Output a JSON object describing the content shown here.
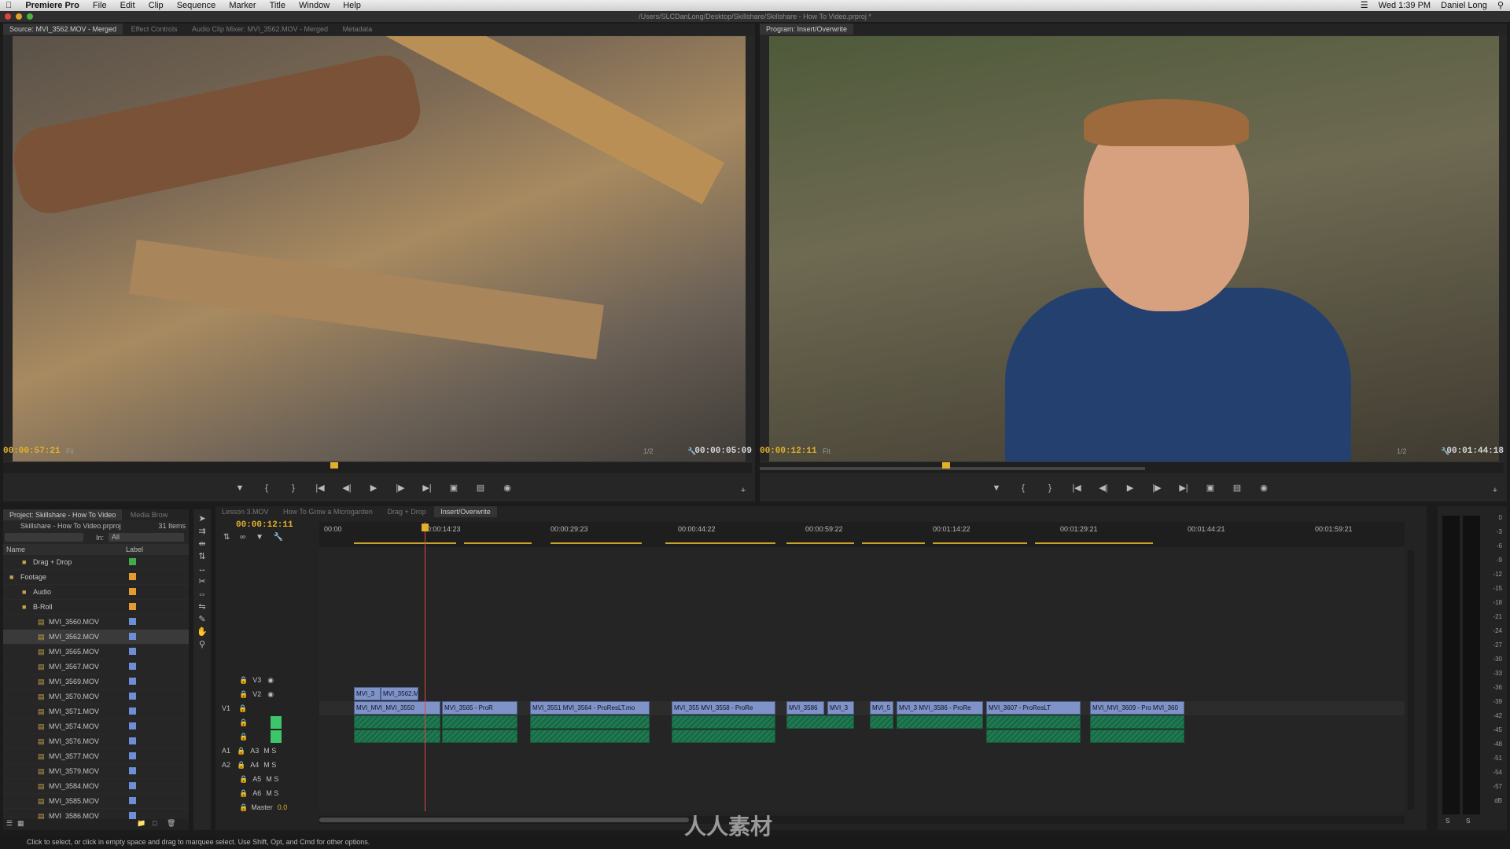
{
  "menubar": {
    "app": "Premiere Pro",
    "items": [
      "File",
      "Edit",
      "Clip",
      "Sequence",
      "Marker",
      "Title",
      "Window",
      "Help"
    ],
    "clock": "Wed 1:39 PM",
    "user": "Daniel Long"
  },
  "window_title": "/Users/SLCDanLong/Desktop/Skillshare/Skillshare - How To Video.prproj *",
  "source_panel": {
    "tabs": [
      "Source: MVI_3562.MOV - Merged",
      "Effect Controls",
      "Audio Clip Mixer: MVI_3562.MOV - Merged",
      "Metadata"
    ],
    "timecode_left": "00:00:57:21",
    "fit": "Fit",
    "resolution": "1/2",
    "timecode_right": "00:00:05:09"
  },
  "program_panel": {
    "tab": "Program: Insert/Overwrite",
    "timecode_left": "00:00:12:11",
    "fit": "Fit",
    "resolution": "1/2",
    "timecode_right": "00:01:44:18"
  },
  "project_panel": {
    "tabs": [
      "Project: Skillshare - How To Video",
      "Media Brow"
    ],
    "file": "Skillshare - How To Video.prproj",
    "count": "31 Items",
    "in_label": "In:",
    "in_value": "All",
    "col_name": "Name",
    "col_label": "Label",
    "items": [
      {
        "name": "Drag + Drop",
        "color": "#3fae49"
      },
      {
        "name": "Footage",
        "color": "#e39b32"
      },
      {
        "name": "Audio",
        "color": "#e39b32"
      },
      {
        "name": "B-Roll",
        "color": "#e39b32"
      },
      {
        "name": "MVI_3560.MOV",
        "color": "#6e8fd6"
      },
      {
        "name": "MVI_3562.MOV",
        "color": "#6e8fd6"
      },
      {
        "name": "MVI_3565.MOV",
        "color": "#6e8fd6"
      },
      {
        "name": "MVI_3567.MOV",
        "color": "#6e8fd6"
      },
      {
        "name": "MVI_3569.MOV",
        "color": "#6e8fd6"
      },
      {
        "name": "MVI_3570.MOV",
        "color": "#6e8fd6"
      },
      {
        "name": "MVI_3571.MOV",
        "color": "#6e8fd6"
      },
      {
        "name": "MVI_3574.MOV",
        "color": "#6e8fd6"
      },
      {
        "name": "MVI_3576.MOV",
        "color": "#6e8fd6"
      },
      {
        "name": "MVI_3577.MOV",
        "color": "#6e8fd6"
      },
      {
        "name": "MVI_3579.MOV",
        "color": "#6e8fd6"
      },
      {
        "name": "MVI_3584.MOV",
        "color": "#6e8fd6"
      },
      {
        "name": "MVI_3585.MOV",
        "color": "#6e8fd6"
      },
      {
        "name": "MVI_3586.MOV",
        "color": "#6e8fd6"
      }
    ]
  },
  "timeline": {
    "tabs": [
      "Lesson 3.MOV",
      "How To Grow a Microgarden",
      "Drag + Drop",
      "Insert/Overwrite"
    ],
    "timecode": "00:00:12:11",
    "ruler": [
      "00:00",
      "00:00:14:23",
      "00:00:29:23",
      "00:00:44:22",
      "00:00:59:22",
      "00:01:14:22",
      "00:01:29:21",
      "00:01:44:21",
      "00:01:59:21"
    ],
    "tracks": {
      "v3": "V3",
      "v2": "V2",
      "v1": "V1",
      "a1": "A1",
      "a2": "A2",
      "a3": "A3",
      "a4": "A4",
      "a5": "A5",
      "a6": "A6",
      "master": "Master",
      "master_val": "0.0"
    },
    "v2_clips": [
      "MVI_3",
      "MVI_3562.M"
    ],
    "v1_clips": [
      "MVI_MVI_MVI_3550",
      "MVI_3565 - ProR",
      "MVI_3551 MVI_3564 - ProResLT.mo",
      "MVI_355 MVI_3558 - ProRe",
      "MVI_3586",
      "MVI_3",
      "MVI_5",
      "MVI_3 MVI_3586 - ProRe",
      "MVI_3607 - ProResLT",
      "MVI_MVI_3609 - Pro MVI_360"
    ]
  },
  "status_bar": "Click to select, or click in empty space and drag to marquee select. Use Shift, Opt, and Cmd for other options.",
  "watermark": "人人素材",
  "vu_ticks": [
    "0",
    "-3",
    "-6",
    "-9",
    "-12",
    "-15",
    "-18",
    "-21",
    "-24",
    "-27",
    "-30",
    "-33",
    "-36",
    "-39",
    "-42",
    "-45",
    "-48",
    "-51",
    "-54",
    "-57",
    "dB"
  ]
}
